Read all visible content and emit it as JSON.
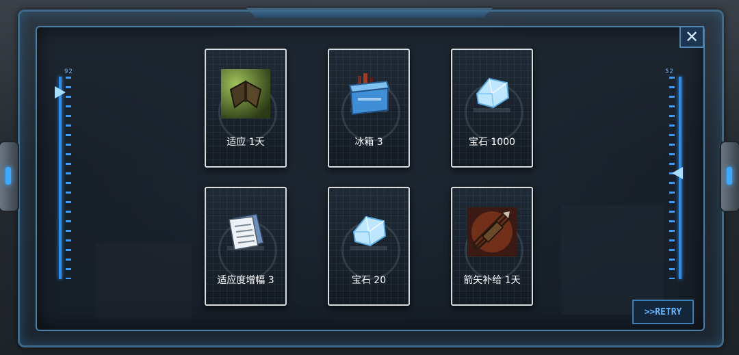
{
  "close_button": {
    "glyph": "✕"
  },
  "gauge_left": {
    "label": "92"
  },
  "gauge_right": {
    "label": "52"
  },
  "rewards": [
    {
      "label": "适应 1天",
      "icon": "moth-icon"
    },
    {
      "label": "冰箱 3",
      "icon": "cooler-box-icon"
    },
    {
      "label": "宝石 1000",
      "icon": "gem-icon"
    },
    {
      "label": "适应度增幅 3",
      "icon": "documents-icon"
    },
    {
      "label": "宝石 20",
      "icon": "gem-icon"
    },
    {
      "label": "箭矢补给 1天",
      "icon": "arrows-bundle-icon"
    }
  ],
  "retry_button": {
    "label": ">>RETRY"
  },
  "colors": {
    "accent": "#3fa8ff",
    "frame": "#4a7fa6",
    "card_border": "#d9dde0",
    "retry_text": "#68b8ff"
  }
}
